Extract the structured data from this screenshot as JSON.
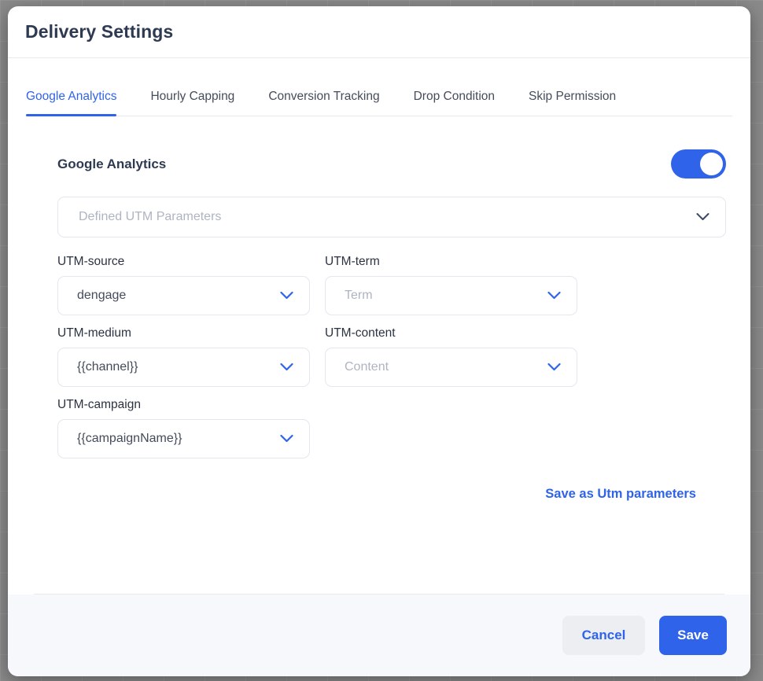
{
  "dialog": {
    "title": "Delivery Settings"
  },
  "tabs": [
    {
      "label": "Google Analytics",
      "active": true
    },
    {
      "label": "Hourly Capping",
      "active": false
    },
    {
      "label": "Conversion Tracking",
      "active": false
    },
    {
      "label": "Drop Condition",
      "active": false
    },
    {
      "label": "Skip Permission",
      "active": false
    }
  ],
  "section": {
    "title": "Google Analytics",
    "toggle_state": "on",
    "defined_utm": {
      "value": "",
      "placeholder": "Defined UTM Parameters"
    }
  },
  "fields": [
    {
      "label": "UTM-source",
      "value": "dengage",
      "placeholder": ""
    },
    {
      "label": "UTM-term",
      "value": "",
      "placeholder": "Term"
    },
    {
      "label": "UTM-medium",
      "value": "{{channel}}",
      "placeholder": ""
    },
    {
      "label": "UTM-content",
      "value": "",
      "placeholder": "Content"
    },
    {
      "label": "UTM-campaign",
      "value": "{{campaignName}}",
      "placeholder": ""
    }
  ],
  "save_utm_link": "Save as Utm parameters",
  "footer": {
    "cancel_label": "Cancel",
    "save_label": "Save"
  },
  "colors": {
    "accent": "#2f63ea",
    "title_text": "#2e3a51",
    "placeholder_text": "#aeb4c2",
    "footer_bg": "#f7f8fb",
    "border": "#e4e7ee"
  },
  "icons": {
    "chevron_down": "chevron-down-icon"
  }
}
